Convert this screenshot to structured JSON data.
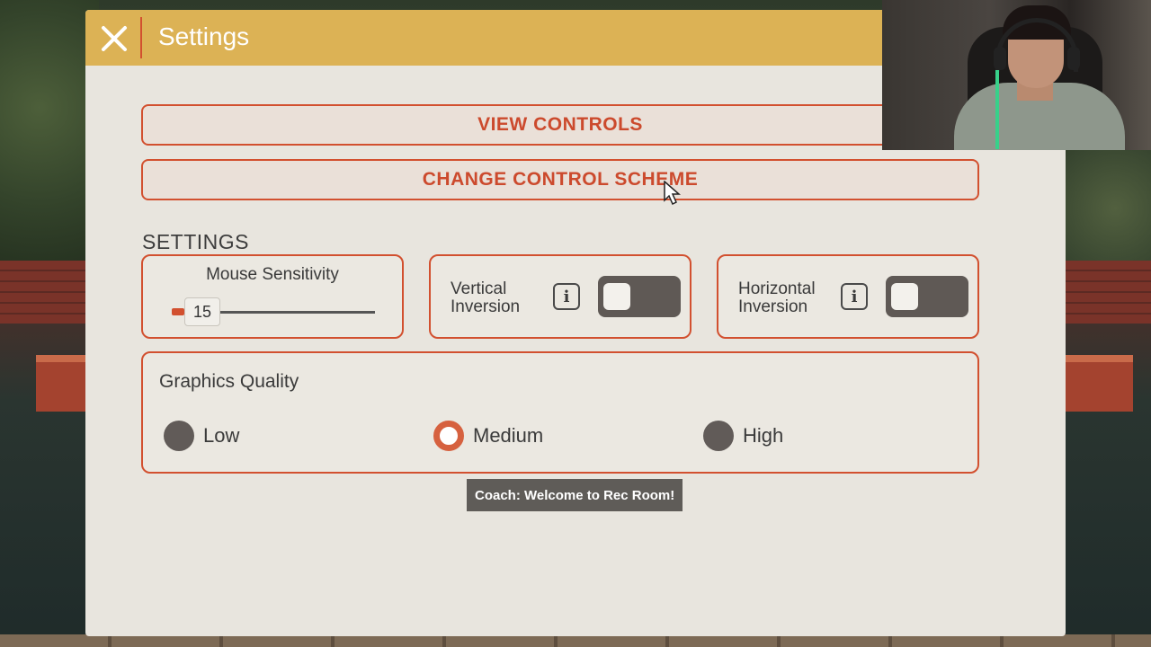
{
  "header": {
    "title": "Settings"
  },
  "buttons": {
    "view_controls": "VIEW CONTROLS",
    "change_control_scheme": "CHANGE CONTROL SCHEME"
  },
  "settings_section": {
    "title": "SETTINGS",
    "mouse_sensitivity": {
      "label": "Mouse Sensitivity",
      "value": "15"
    },
    "vertical_inversion": {
      "label_line1": "Vertical",
      "label_line2": "Inversion",
      "enabled": false
    },
    "horizontal_inversion": {
      "label_line1": "Horizontal",
      "label_line2": "Inversion",
      "enabled": false
    }
  },
  "graphics": {
    "label": "Graphics Quality",
    "options": [
      "Low",
      "Medium",
      "High"
    ],
    "selected": "Medium"
  },
  "toast": {
    "text": "Coach: Welcome to Rec Room!"
  },
  "icons": {
    "close": "close-icon",
    "info": "info-icon",
    "cursor": "mouse-pointer-icon"
  },
  "colors": {
    "header_bg": "#dcb255",
    "accent": "#d2502f",
    "panel_bg": "#e8e5de",
    "toggle_off": "#5f5955",
    "radio_selected": "#d6613f"
  }
}
